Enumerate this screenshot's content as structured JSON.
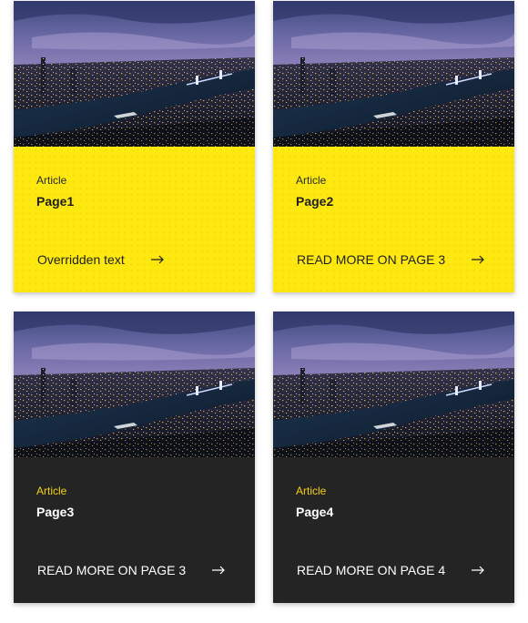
{
  "cards": [
    {
      "type_label": "Article",
      "title": "Page1",
      "cta_label": "Overridden text",
      "theme": "yellow"
    },
    {
      "type_label": "Article",
      "title": "Page2",
      "cta_label": "READ MORE ON PAGE 3",
      "theme": "yellow"
    },
    {
      "type_label": "Article",
      "title": "Page3",
      "cta_label": "READ MORE ON PAGE 3",
      "theme": "dark"
    },
    {
      "type_label": "Article",
      "title": "Page4",
      "cta_label": "READ MORE ON PAGE 4",
      "theme": "dark"
    }
  ],
  "colors": {
    "yellow_bg": "#fde910",
    "dark_bg": "#242424",
    "dark_accent": "#f7d117"
  },
  "icons": {
    "cta_arrow": "arrow-right-icon",
    "card_image": "city-night-photo"
  }
}
